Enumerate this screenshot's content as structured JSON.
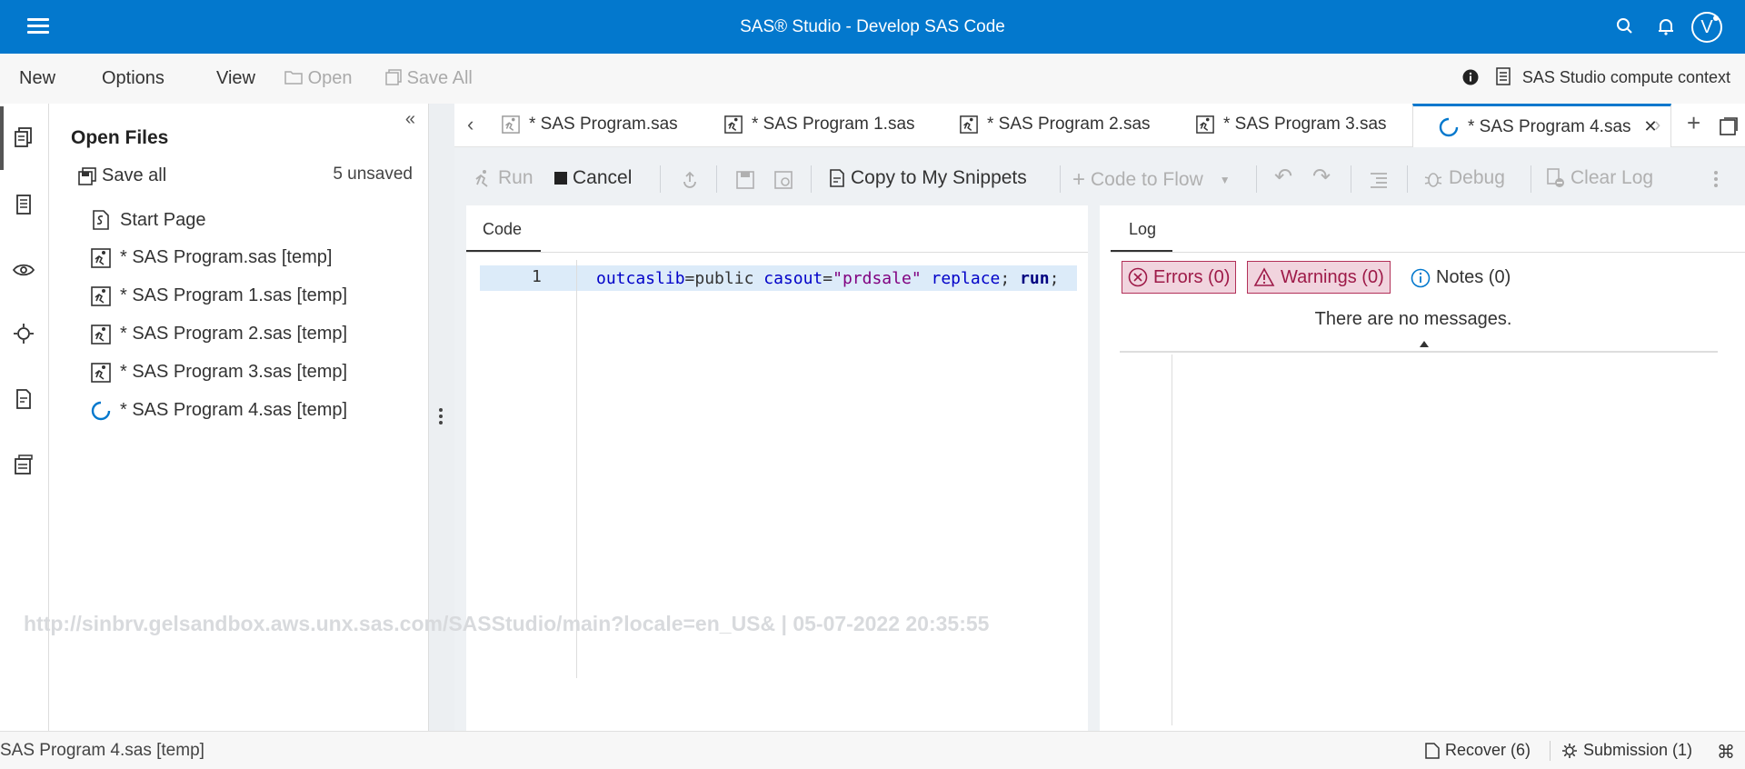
{
  "header": {
    "title": "SAS® Studio - Develop SAS Code",
    "avatar_initial": "V",
    "accent": "#0378cd"
  },
  "menubar": {
    "new": "New",
    "options": "Options",
    "view": "View",
    "open": "Open",
    "save_all": "Save All",
    "context": "SAS Studio compute context"
  },
  "open_files": {
    "title": "Open Files",
    "save_all": "Save all",
    "unsaved": "5 unsaved",
    "items": [
      "Start Page",
      "* SAS Program.sas [temp]",
      "* SAS Program 1.sas [temp]",
      "* SAS Program 2.sas [temp]",
      "* SAS Program 3.sas [temp]",
      "* SAS Program 4.sas [temp]"
    ]
  },
  "tabs": [
    "* SAS Program.sas",
    "* SAS Program 1.sas",
    "* SAS Program 2.sas",
    "* SAS Program 3.sas",
    "* SAS Program 4.sas"
  ],
  "toolbar": {
    "run": "Run",
    "cancel": "Cancel",
    "copy_snippets": "Copy to My Snippets",
    "code_to_flow": "Code to Flow",
    "debug": "Debug",
    "clear_log": "Clear Log"
  },
  "code": {
    "tab": "Code",
    "line_number": "1",
    "tokens": {
      "t1": "outcaslib",
      "t2": "=public ",
      "t3": "casout",
      "t4": "=",
      "t5": "\"prdsale\"",
      "t6": " replace",
      "t7": "; ",
      "t8": "run",
      "t9": ";"
    }
  },
  "log": {
    "tab": "Log",
    "errors": "Errors (0)",
    "warnings": "Warnings (0)",
    "notes": "Notes (0)",
    "no_messages": "There are no messages."
  },
  "watermark": "http://sinbrv.gelsandbox.aws.unx.sas.com/SASStudio/main?locale=en_US& | 05-07-2022 20:35:55",
  "status": {
    "file": "SAS Program 4.sas [temp]",
    "recover": "Recover (6)",
    "submission": "Submission (1)"
  }
}
